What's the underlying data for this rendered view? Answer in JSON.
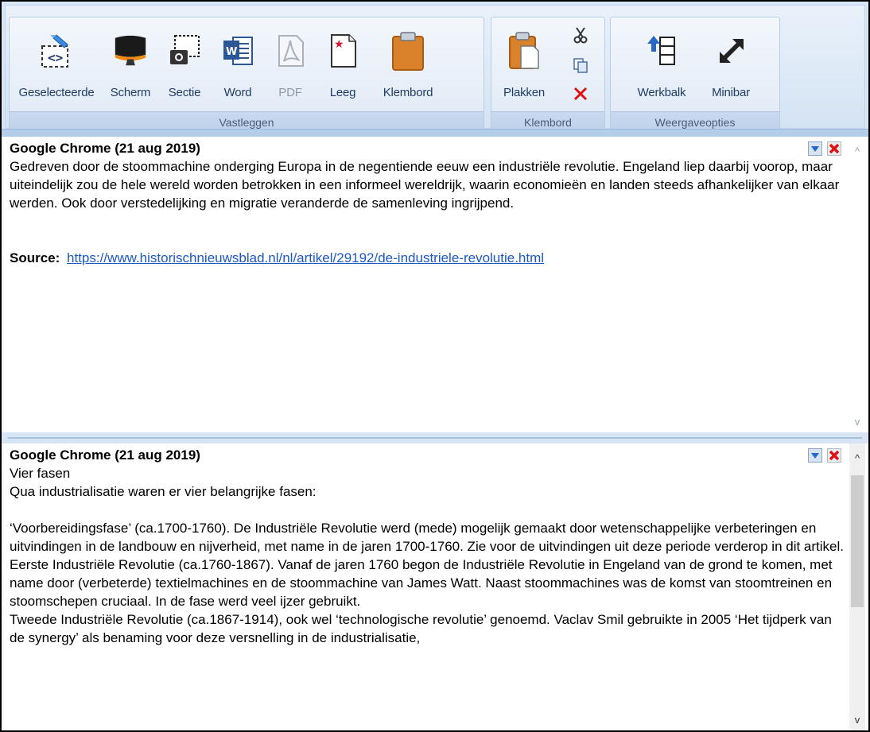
{
  "ribbon": {
    "groups": [
      {
        "label": "Vastleggen",
        "buttons": [
          {
            "label": "Geselecteerde",
            "icon": "selection-capture-icon"
          },
          {
            "label": "Scherm",
            "icon": "monitor-icon"
          },
          {
            "label": "Sectie",
            "icon": "section-camera-icon"
          },
          {
            "label": "Word",
            "icon": "word-document-icon"
          },
          {
            "label": "PDF",
            "icon": "pdf-icon"
          },
          {
            "label": "Leeg",
            "icon": "blank-page-icon"
          },
          {
            "label": "Klembord",
            "icon": "clipboard-icon"
          }
        ]
      },
      {
        "label": "Klembord",
        "buttons": [
          {
            "label": "Plakken",
            "icon": "paste-icon"
          }
        ],
        "small": [
          "cut-icon",
          "copy-icon",
          "delete-icon"
        ]
      },
      {
        "label": "Weergaveopties",
        "buttons": [
          {
            "label": "Werkbalk",
            "icon": "toolbar-icon"
          },
          {
            "label": "Minibar",
            "icon": "expand-arrow-icon"
          }
        ]
      }
    ]
  },
  "clips": [
    {
      "title": "Google Chrome (21 aug 2019)",
      "body": "Gedreven door de stoommachine onderging Europa in de negentiende eeuw een industriële revolutie. Engeland liep daarbij voorop, maar uiteindelijk zou de hele wereld worden betrokken in een informeel wereldrijk, waarin economieën en landen steeds afhankelijker van elkaar werden. Ook door verstedelijking en migratie veranderde de samenleving ingrijpend.",
      "source_label": "Source:",
      "source_url": "https://www.historischnieuwsblad.nl/nl/artikel/29192/de-industriele-revolutie.html"
    },
    {
      "title": "Google Chrome (21 aug 2019)",
      "lines": [
        "Vier fasen",
        "Qua industrialisatie waren er vier belangrijke fasen:",
        "",
        "‘Voorbereidingsfase’ (ca.1700-1760). De Industriële Revolutie werd (mede) mogelijk gemaakt door wetenschappelijke verbeteringen en uitvindingen in de landbouw en nijverheid, met name in de jaren 1700-1760. Zie voor de uitvindingen uit deze periode verderop in dit artikel.",
        "Eerste Industriële Revolutie (ca.1760-1867). Vanaf de jaren 1760 begon de Industriële Revolutie in Engeland van de grond te komen, met name door (verbeterde) textielmachines en de stoommachine van James Watt. Naast stoommachines was de komst van stoomtreinen en stoomschepen cruciaal. In de fase werd veel ijzer gebruikt.",
        "Tweede Industriële Revolutie (ca.1867-1914), ook wel ‘technologische revolutie’ genoemd. Vaclav Smil gebruikte in 2005 ‘Het tijdperk van de synergy’ als benaming voor deze versnelling in de industrialisatie,"
      ]
    }
  ],
  "colors": {
    "ribbon_bg": "#d7e6f5",
    "label_text": "#1f3d66",
    "link": "#1b58c4",
    "delete_red": "#e01010"
  }
}
